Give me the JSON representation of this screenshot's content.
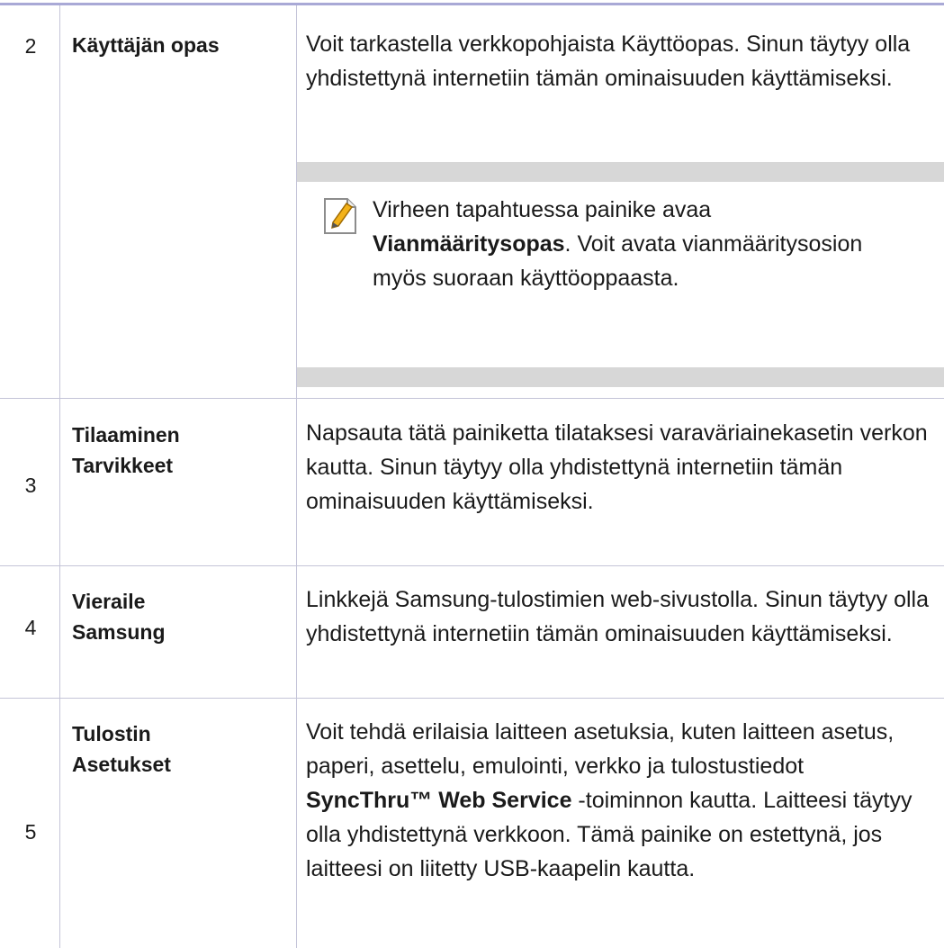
{
  "rows": [
    {
      "number": "2",
      "feature": "Käyttäjän opas",
      "description": "Voit tarkastella verkkopohjaista Käyttöopas. Sinun täytyy olla yhdistettynä internetiin tämän ominaisuuden käyttämiseksi.",
      "note": {
        "icon": "note-pencil-icon",
        "before": "Virheen tapahtuessa painike avaa ",
        "bold": "Vianmääritysopas",
        "after": ". Voit avata vianmääritysosion myös suoraan käyttöoppaasta."
      }
    },
    {
      "number": "3",
      "feature_line1": "Tilaaminen",
      "feature_line2": "Tarvikkeet",
      "description": "Napsauta tätä painiketta tilataksesi varaväriainekasetin verkon kautta. Sinun täytyy olla yhdistettynä internetiin tämän ominaisuuden käyttämiseksi."
    },
    {
      "number": "4",
      "feature_line1": "Vieraile",
      "feature_line2": "Samsung",
      "description": "Linkkejä Samsung-tulostimien web-sivustolla. Sinun täytyy olla yhdistettynä internetiin tämän ominaisuuden käyttämiseksi."
    },
    {
      "number": "5",
      "feature_line1": "Tulostin",
      "feature_line2": "Asetukset",
      "description_before": "Voit tehdä erilaisia laitteen asetuksia, kuten laitteen asetus, paperi, asettelu, emulointi, verkko ja tulostustiedot ",
      "description_bold": "SyncThru™ Web Service",
      "description_after": " -toiminnon kautta. Laitteesi täytyy olla yhdistettynä verkkoon. Tämä painike on estettynä, jos laitteesi on liitetty USB-kaapelin kautta."
    }
  ],
  "colors": {
    "top_rule": "#a9a9d6",
    "grid_line": "#c4c4d8",
    "note_band": "#d7d7d7"
  }
}
